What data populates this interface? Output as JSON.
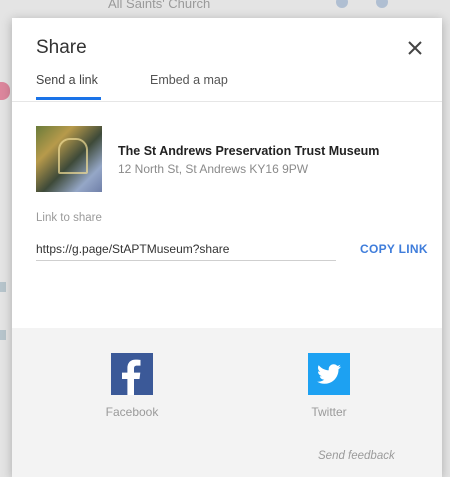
{
  "background": {
    "map_label": "All Saints' Church"
  },
  "dialog": {
    "title": "Share",
    "tabs": [
      {
        "label": "Send a link",
        "active": true
      },
      {
        "label": "Embed a map",
        "active": false
      }
    ],
    "place": {
      "name": "The St Andrews Preservation Trust Museum",
      "address": "12 North St, St Andrews KY16 9PW"
    },
    "link": {
      "label": "Link to share",
      "value": "https://g.page/StAPTMuseum?share",
      "copy_label": "COPY LINK"
    },
    "social": [
      {
        "label": "Facebook",
        "icon": "facebook-icon",
        "color": "#3b5998"
      },
      {
        "label": "Twitter",
        "icon": "twitter-icon",
        "color": "#1da1f2"
      }
    ],
    "feedback": "Send feedback"
  },
  "colors": {
    "accent": "#1a73e8",
    "link": "#3f7ddb"
  }
}
